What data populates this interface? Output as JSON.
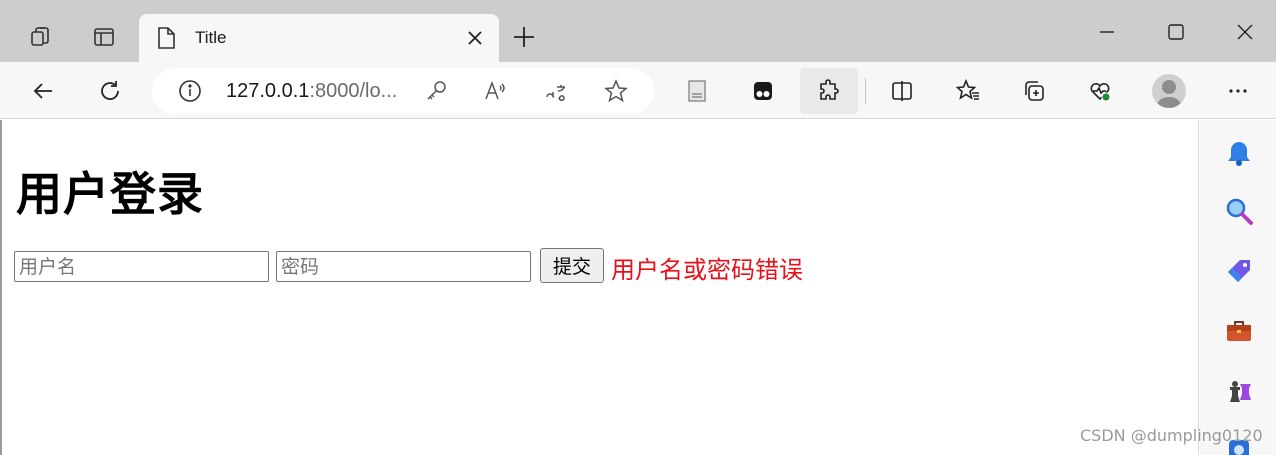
{
  "browser": {
    "tab": {
      "title": "Title"
    },
    "address_bar": {
      "url_host": "127.0.0.1",
      "url_rest": ":8000/lo..."
    },
    "colors": {
      "tabstrip": "#cdcdcd",
      "toolbar": "#f7f7f7",
      "active_tab": "#f7f7f7"
    }
  },
  "page": {
    "heading": "用户登录",
    "form": {
      "username_placeholder": "用户名",
      "password_placeholder": "密码",
      "submit_label": "提交"
    },
    "error_message": "用户名或密码错误",
    "colors": {
      "error": "#e8101a"
    }
  },
  "watermark": "CSDN @dumpling0120"
}
